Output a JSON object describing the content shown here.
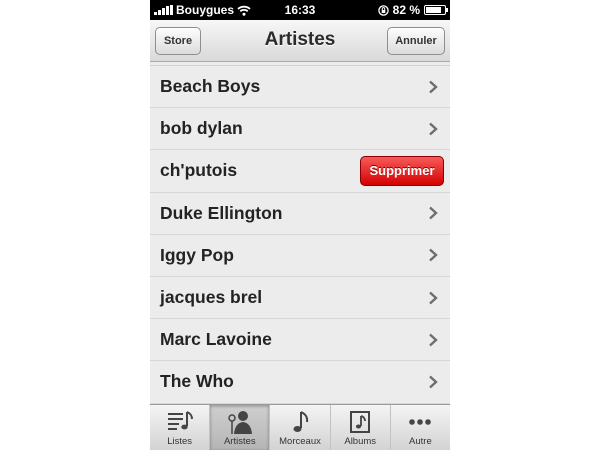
{
  "status_bar": {
    "carrier": "Bouygues",
    "time": "16:33",
    "battery": "82 %",
    "battery_level": 0.82
  },
  "nav": {
    "title": "Artistes",
    "left_button": "Store",
    "right_button": "Annuler"
  },
  "artists": [
    {
      "name": "Beach Boys"
    },
    {
      "name": "bob dylan"
    },
    {
      "name": "ch'putois",
      "delete_label": "Supprimer"
    },
    {
      "name": "Duke Ellington"
    },
    {
      "name": "Iggy Pop"
    },
    {
      "name": "jacques brel"
    },
    {
      "name": "Marc Lavoine"
    },
    {
      "name": "The Who"
    }
  ],
  "tabs": [
    {
      "label": "Listes",
      "icon": "playlist-icon"
    },
    {
      "label": "Artistes",
      "icon": "artist-icon",
      "active": true
    },
    {
      "label": "Morceaux",
      "icon": "music-note-icon"
    },
    {
      "label": "Albums",
      "icon": "album-icon"
    },
    {
      "label": "Autre",
      "icon": "more-icon"
    }
  ],
  "colors": {
    "delete": "#e00000",
    "background": "#ececec",
    "status_bar": "#000000"
  }
}
